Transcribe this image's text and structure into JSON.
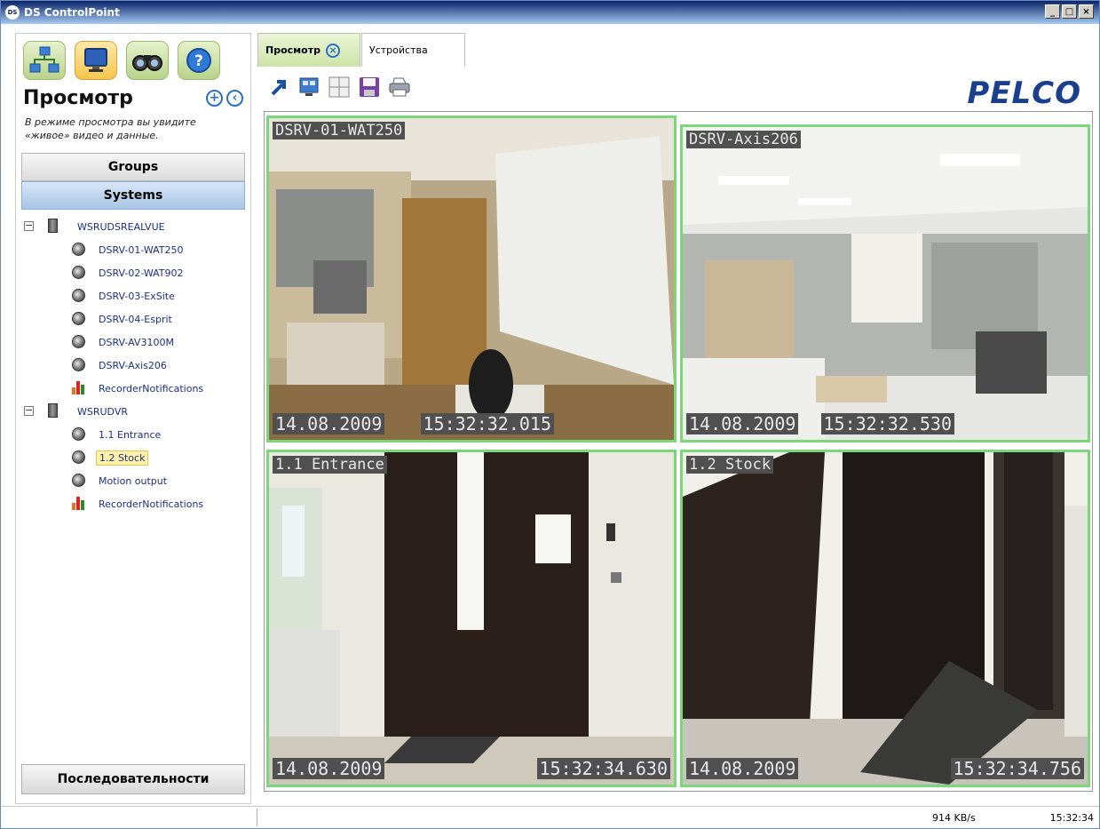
{
  "window": {
    "title": "DS ControlPoint",
    "minimize": "_",
    "maximize": "□",
    "close": "×"
  },
  "sidebar": {
    "title": "Просмотр",
    "description": "В режиме просмотра вы увидите «живое» видео и данные.",
    "groups_label": "Groups",
    "systems_label": "Systems",
    "sequences_label": "Последовательности",
    "add": "+",
    "back": "‹"
  },
  "tree": {
    "server1": "WSRUDSREALVUE",
    "cam1": "DSRV-01-WAT250",
    "cam2": "DSRV-02-WAT902",
    "cam3": "DSRV-03-ExSite",
    "cam4": "DSRV-04-Esprit",
    "cam5": "DSRV-AV3100M",
    "cam6": "DSRV-Axis206",
    "rec1": "RecorderNotifications",
    "server2": "WSRUDVR",
    "cam7": "1.1 Entrance",
    "cam8": "1.2 Stock",
    "cam9": "Motion output",
    "rec2": "RecorderNotifications",
    "expand": "−"
  },
  "tabs": {
    "view": "Просмотр",
    "devices": "Устройства",
    "close": "×"
  },
  "brand": "PELCO",
  "views": {
    "v1": {
      "name": "DSRV-01-WAT250",
      "date": "14.08.2009",
      "time": "15:32:32.015"
    },
    "v2": {
      "name": "DSRV-Axis206",
      "date": "14.08.2009",
      "time": "15:32:32.530"
    },
    "v3": {
      "name": "1.1 Entrance",
      "date": "14.08.2009",
      "time": "15:32:34.630"
    },
    "v4": {
      "name": "1.2 Stock",
      "date": "14.08.2009",
      "time": "15:32:34.756"
    }
  },
  "status": {
    "bandwidth": "914 KB/s",
    "clock": "15:32:34"
  },
  "colors": {
    "accent": "#2870c8",
    "view_border": "#7cd67c",
    "brand": "#1a3f8e"
  }
}
